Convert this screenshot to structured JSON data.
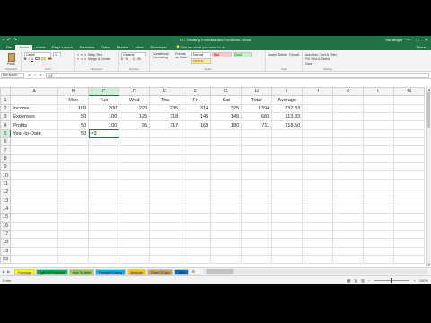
{
  "window": {
    "title": "01 - Creating Formulas and Functions - Excel",
    "user": "Tim Wright",
    "controls": [
      "—",
      "□",
      "✕"
    ]
  },
  "ribbon": {
    "tabs": [
      "File",
      "Home",
      "Insert",
      "Page Layout",
      "Formulas",
      "Data",
      "Review",
      "View",
      "Developer"
    ],
    "active_tab": "Home",
    "tell_me": "Tell me what you want to do",
    "share": "Share",
    "clipboard": {
      "paste": "Paste",
      "label": "Clipboard"
    },
    "font": {
      "name": "Calibri",
      "size": "11",
      "label": "Font"
    },
    "alignment": {
      "label": "Alignment",
      "wrap": "Wrap Text",
      "merge": "Merge & Center"
    },
    "number": {
      "format": "General",
      "label": "Number"
    },
    "styles": {
      "conditional": "Conditional Formatting",
      "format_table": "Format as Table",
      "normal": "Normal",
      "bad": "Bad",
      "good": "Good",
      "neutral": "Neutral",
      "label": "Styles"
    },
    "cells": {
      "insert": "Insert",
      "delete": "Delete",
      "format": "Format",
      "label": "Cells"
    },
    "editing": {
      "autosum": "AutoSum",
      "fill": "Fill",
      "clear": "Clear",
      "sort": "Sort & Filter",
      "find": "Find & Select",
      "label": "Editing"
    }
  },
  "formula_bar": {
    "name_box": "AVERAGE",
    "cancel": "✕",
    "enter": "✓",
    "fx": "fx",
    "value": "=3"
  },
  "grid": {
    "columns": [
      "A",
      "B",
      "C",
      "D",
      "E",
      "F",
      "G",
      "H",
      "I",
      "J",
      "K",
      "L",
      "M"
    ],
    "row_numbers": [
      "1",
      "2",
      "3",
      "4",
      "5",
      "6",
      "7",
      "8",
      "9",
      "10",
      "11",
      "12",
      "13",
      "14",
      "15",
      "16",
      "17",
      "18",
      "19",
      "20"
    ],
    "header_row": [
      "",
      "Mon",
      "Tue",
      "Wed",
      "Thu",
      "Fri",
      "Sat",
      "Total",
      "Average"
    ],
    "rows": [
      [
        "Income",
        "100",
        "200",
        "220",
        "235",
        "314",
        "325",
        "1394",
        "232.33"
      ],
      [
        "Expenses",
        "50",
        "100",
        "125",
        "118",
        "145",
        "145",
        "683",
        "113.83"
      ],
      [
        "Profits",
        "50",
        "100",
        "95",
        "117",
        "169",
        "180",
        "711",
        "118.50"
      ],
      [
        "Year-to-Date",
        "50",
        "=3",
        "",
        "",
        "",
        "",
        "",
        ""
      ]
    ],
    "active_cell": "C5"
  },
  "sheets": {
    "tabs": [
      {
        "name": "Formulas",
        "color": "#ffff00"
      },
      {
        "name": "Type Of Formulas",
        "color": "#00b050"
      },
      {
        "name": "How To Write",
        "color": "#92d050"
      },
      {
        "name": "Principle Calcing",
        "color": "#00b0f0"
      },
      {
        "name": "Absolute",
        "color": "#ffc000"
      },
      {
        "name": "Order Of Ops",
        "color": "#c4a55e"
      },
      {
        "name": "Joins",
        "color": "#0070c0"
      }
    ],
    "add": "⊕"
  },
  "status": {
    "mode": "Enter",
    "zoom": "100%"
  }
}
